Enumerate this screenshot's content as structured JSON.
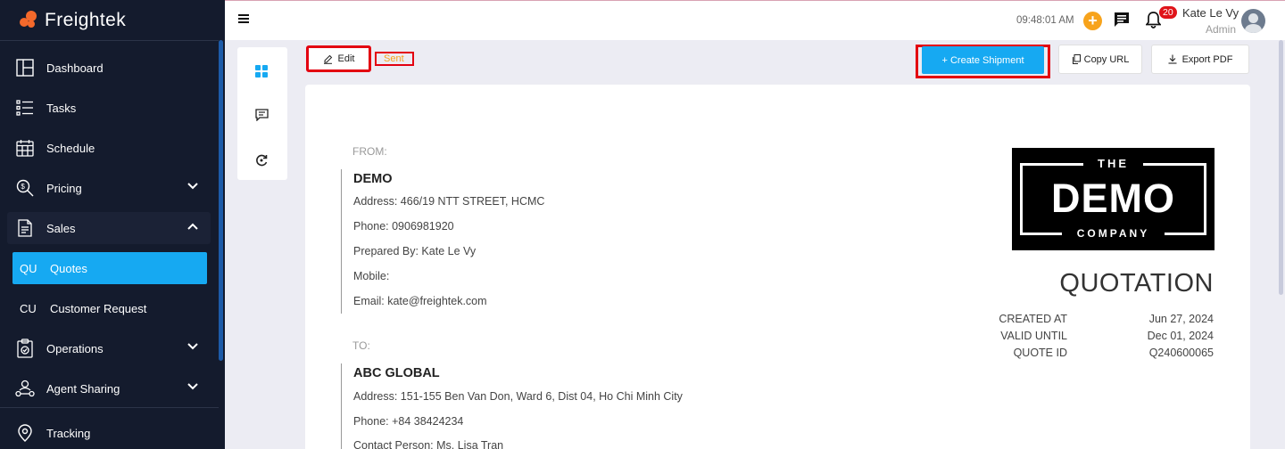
{
  "app": {
    "name": "Freightek"
  },
  "sidebar": {
    "items": [
      {
        "label": "Dashboard",
        "icon": "dashboard-icon"
      },
      {
        "label": "Tasks",
        "icon": "tasks-icon"
      },
      {
        "label": "Schedule",
        "icon": "calendar-icon"
      },
      {
        "label": "Pricing",
        "icon": "pricing-search-icon"
      },
      {
        "label": "Sales",
        "icon": "document-icon"
      },
      {
        "abbr": "QU",
        "label": "Quotes"
      },
      {
        "abbr": "CU",
        "label": "Customer Request"
      },
      {
        "label": "Operations",
        "icon": "clipboard-icon"
      },
      {
        "label": "Agent Sharing",
        "icon": "agent-sharing-icon"
      },
      {
        "label": "Tracking",
        "icon": "location-pin-icon"
      }
    ]
  },
  "topbar": {
    "time": "09:48:01 AM",
    "notification_count": "20",
    "user_name": "Kate Le Vy",
    "user_role": "Admin"
  },
  "toolbar": {
    "edit_label": "Edit",
    "status": "Sent",
    "create_shipment_label": "+ Create Shipment",
    "copy_url_label": "Copy URL",
    "export_pdf_label": "Export PDF"
  },
  "document": {
    "from_label": "FROM:",
    "to_label": "TO:",
    "from": {
      "name": "DEMO",
      "address": "Address: 466/19 NTT STREET, HCMC",
      "phone": "Phone: 0906981920",
      "prepared_by": "Prepared By: Kate Le Vy",
      "mobile": "Mobile:",
      "email": "Email: kate@freightek.com"
    },
    "to": {
      "name": "ABC GLOBAL",
      "address": "Address: 151-155 Ben Van Don, Ward 6, Dist 04, Ho Chi Minh City",
      "phone": "Phone: +84 38424234",
      "contact": "Contact Person: Ms. Lisa Tran"
    },
    "logo": {
      "the": "THE",
      "demo": "DEMO",
      "company": "COMPANY"
    },
    "title": "QUOTATION",
    "meta": [
      {
        "label": "CREATED AT",
        "value": "Jun 27, 2024"
      },
      {
        "label": "VALID UNTIL",
        "value": "Dec 01, 2024"
      },
      {
        "label": "QUOTE ID",
        "value": "Q240600065"
      }
    ]
  },
  "colors": {
    "sidebar_bg": "#141b2d",
    "accent": "#16a9f2",
    "brand_orange": "#f4692b",
    "highlight_red": "#e30010"
  }
}
